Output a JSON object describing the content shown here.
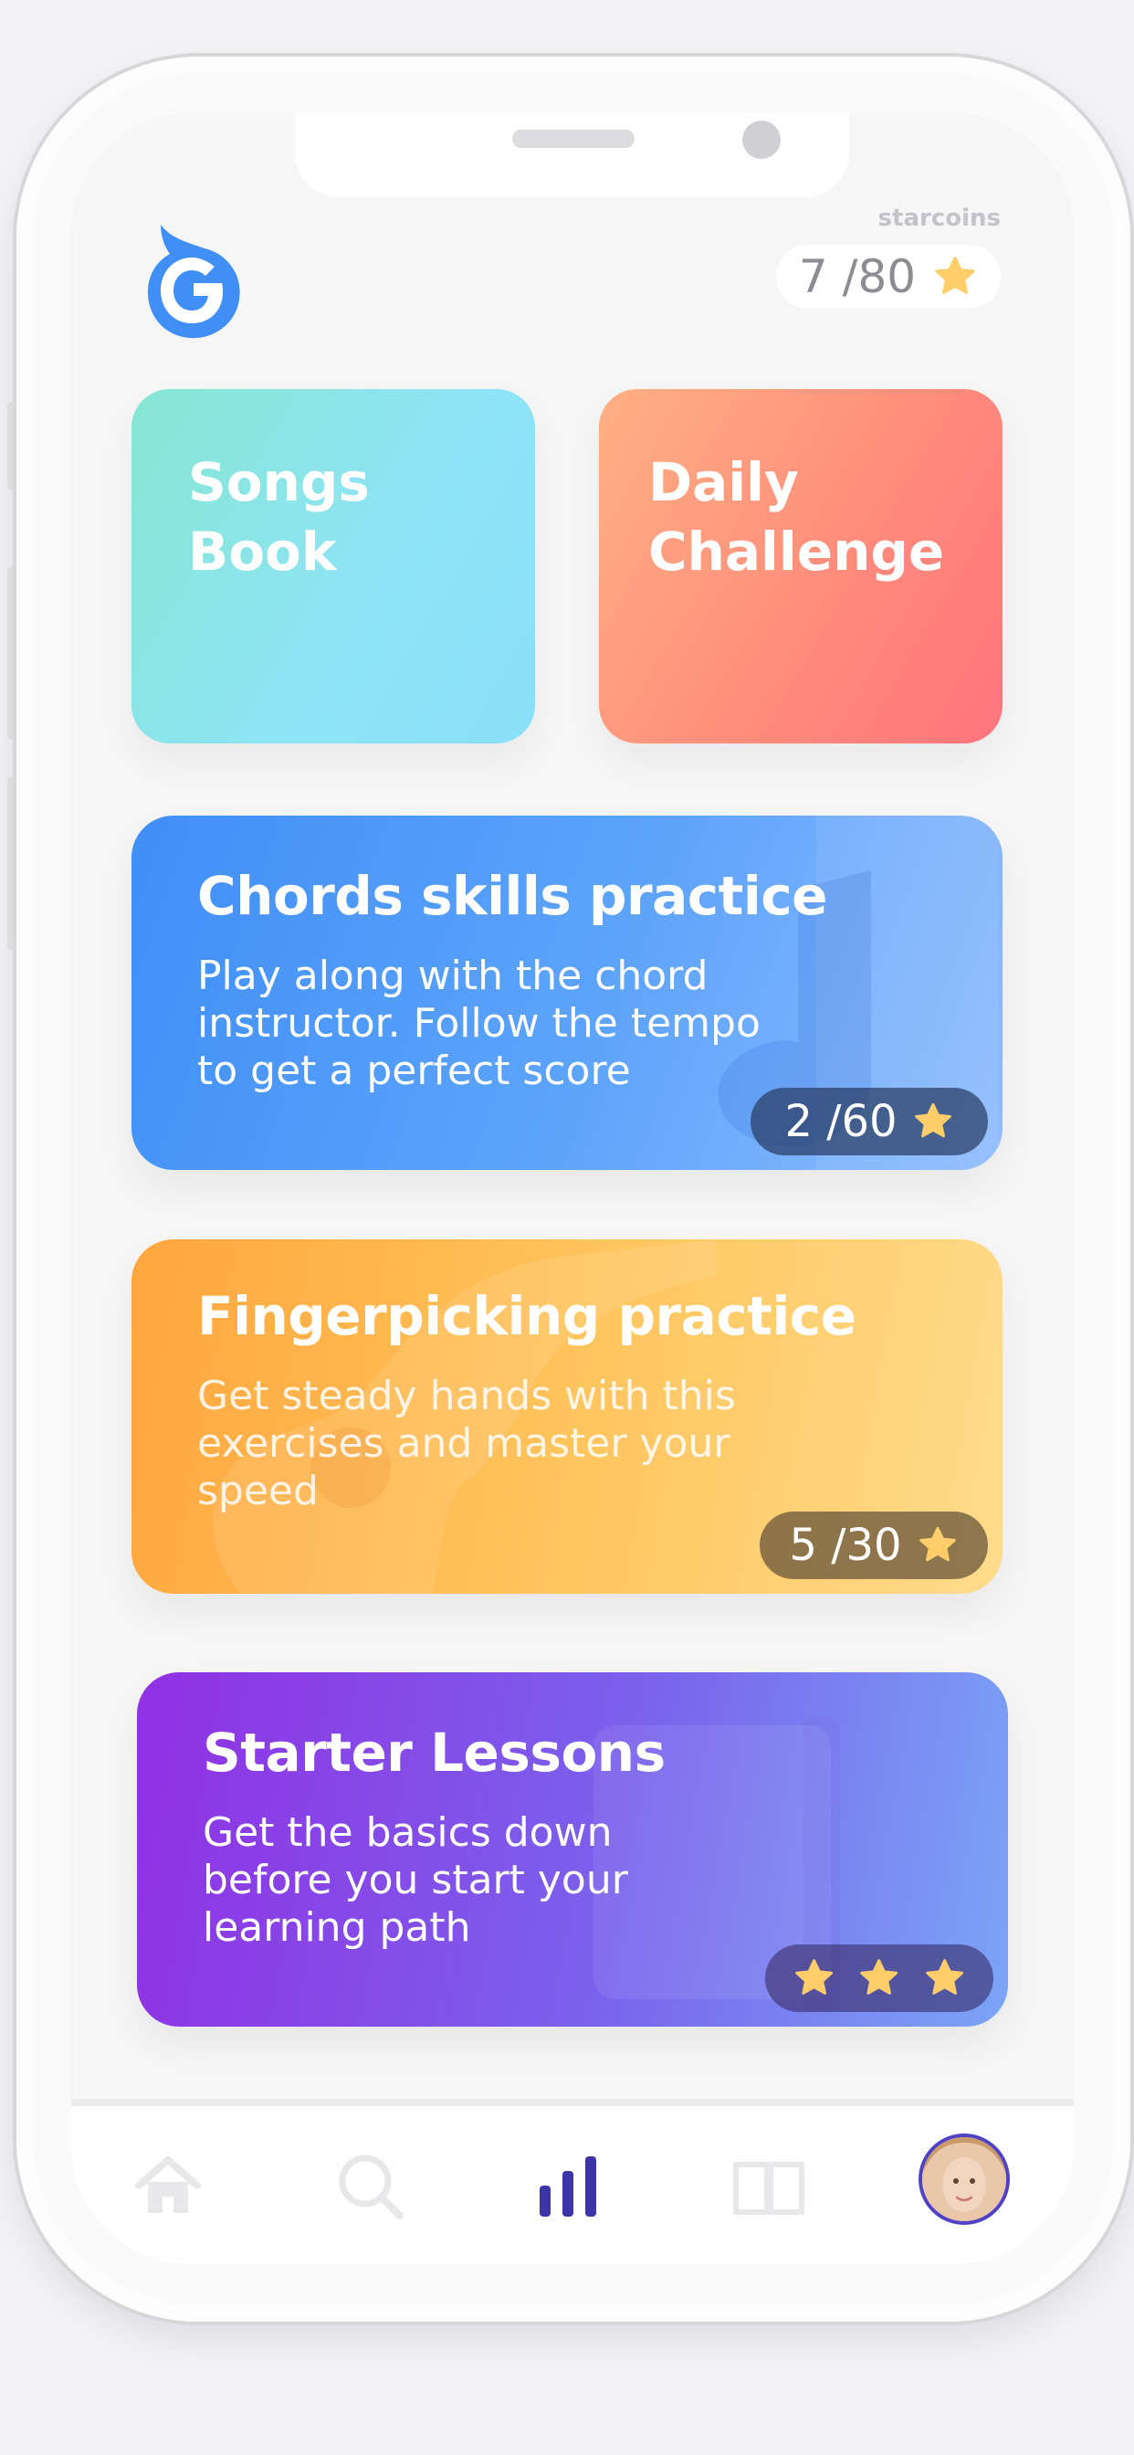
{
  "header": {
    "coins_label": "starcoins",
    "coins_value": "7 /80",
    "coins_icon": "star-icon"
  },
  "tiles": [
    {
      "title_line1": "Songs",
      "title_line2": "Book"
    },
    {
      "title_line1": "Daily",
      "title_line2": "Challenge"
    }
  ],
  "cards": [
    {
      "title": "Chords skills practice",
      "description": "Play along with the chord instructor. Follow the tempo to get a perfect score",
      "progress": "2 /60"
    },
    {
      "title": "Fingerpicking practice",
      "description": "Get steady hands with this exercises and master your speed",
      "progress": "5 /30"
    },
    {
      "title": "Starter Lessons",
      "description": "Get the basics down before you start your learning path",
      "stars": 3
    }
  ],
  "tabbar": {
    "items": [
      "home-icon",
      "search-icon",
      "stats-icon",
      "book-icon",
      "profile-avatar"
    ],
    "active": "stats-icon"
  },
  "colors": {
    "accent": "#3b35a8",
    "star": "#ffcd6a",
    "logo": "#3f8ff7"
  }
}
